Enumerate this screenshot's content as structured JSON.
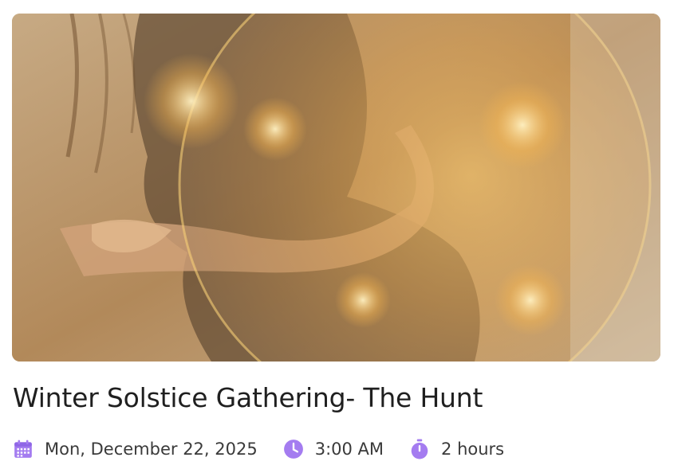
{
  "event": {
    "title": "Winter Solstice Gathering- The Hunt",
    "date": "Mon, December 22, 2025",
    "time": "3:00 AM",
    "duration": "2 hours"
  },
  "icons": {
    "date": "calendar-icon",
    "time": "clock-icon",
    "duration": "stopwatch-icon"
  },
  "colors": {
    "icon_accent": "#a47cf0",
    "title_text": "#1f1f1f",
    "meta_text": "#3a3a3a"
  }
}
